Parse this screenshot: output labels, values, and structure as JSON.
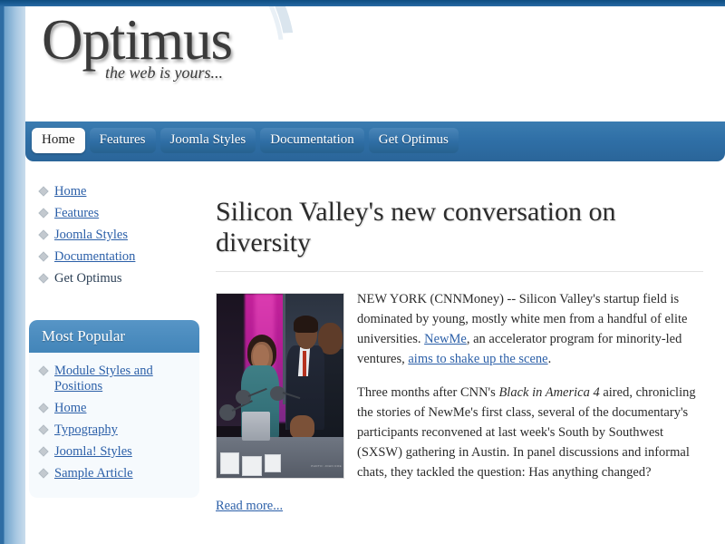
{
  "site": {
    "logo_title": "Optimus",
    "logo_tagline": "the web is yours..."
  },
  "nav": {
    "items": [
      {
        "label": "Home",
        "active": true
      },
      {
        "label": "Features",
        "active": false
      },
      {
        "label": "Joomla Styles",
        "active": false
      },
      {
        "label": "Documentation",
        "active": false
      },
      {
        "label": "Get Optimus",
        "active": false
      }
    ]
  },
  "sidebar": {
    "main_menu": {
      "items": [
        {
          "label": "Home",
          "linked": true
        },
        {
          "label": "Features",
          "linked": true
        },
        {
          "label": "Joomla Styles",
          "linked": true
        },
        {
          "label": "Documentation",
          "linked": true
        },
        {
          "label": "Get Optimus",
          "linked": false
        }
      ]
    },
    "most_popular": {
      "title": "Most Popular",
      "items": [
        {
          "label": "Module Styles and Positions",
          "linked": true
        },
        {
          "label": "Home",
          "linked": true
        },
        {
          "label": "Typography",
          "linked": true
        },
        {
          "label": "Joomla! Styles",
          "linked": true
        },
        {
          "label": "Sample Article",
          "linked": true
        }
      ]
    }
  },
  "article": {
    "title": "Silicon Valley's new conversation on diversity",
    "photo_credit": "PHOTO: JOHN DOE",
    "paragraph1": {
      "part1": "NEW YORK (CNNMoney) -- Silicon Valley's startup field is dominated by young, mostly white men from a handful of elite universities. ",
      "link1": "NewMe",
      "part2": ", an accelerator program for minority-led ventures, ",
      "link2": "aims to shake up the scene",
      "part3": "."
    },
    "paragraph2": {
      "part1": "Three months after CNN's ",
      "italic": "Black in America 4",
      "part2": " aired, chronicling the stories of NewMe's first class, several of the documentary's participants reconvened at last week's South by Southwest (SXSW) gathering in Austin. In panel discussions and informal chats, they tackled the question: Has anything changed?"
    },
    "read_more": "Read more..."
  },
  "colors": {
    "brand_blue": "#2e6da4",
    "nav_blue": "#3b7cb0",
    "module_head_blue": "#4a8bbe",
    "link_blue": "#2b5fa8",
    "top_strip": "#1a5c94"
  }
}
